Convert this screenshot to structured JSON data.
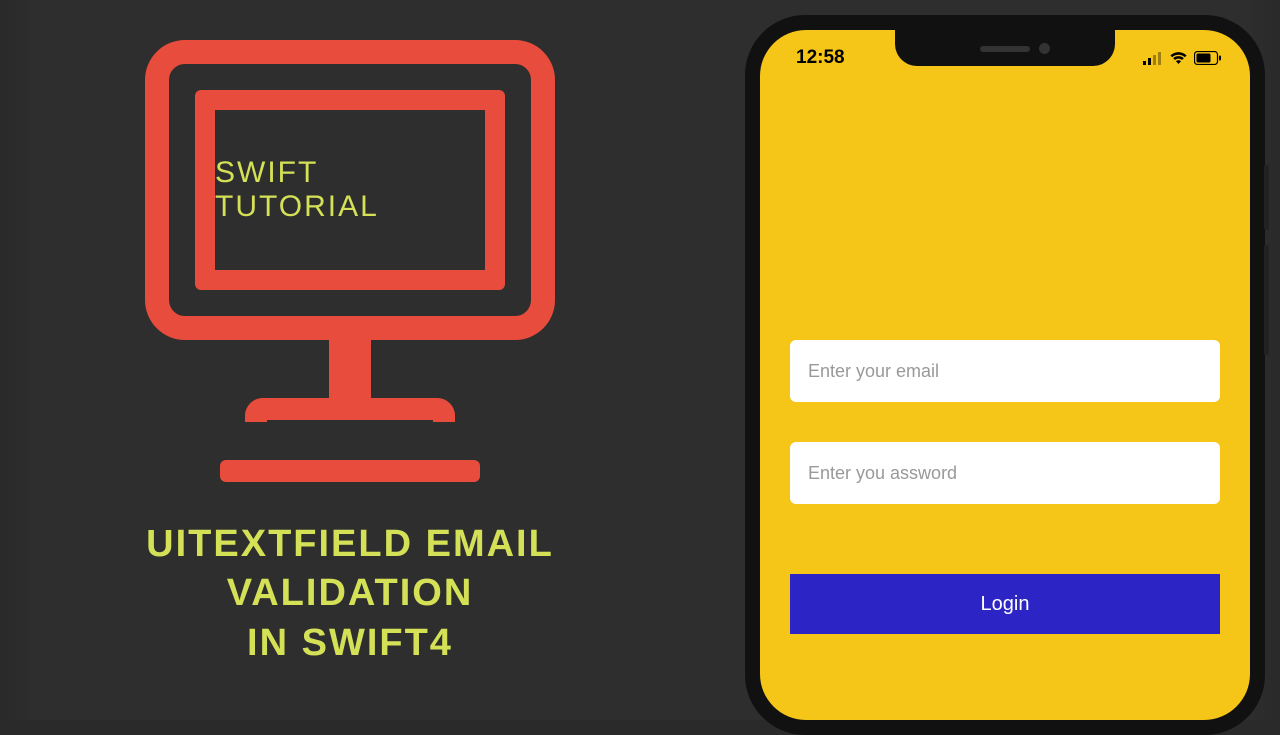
{
  "left": {
    "monitor_text": "SWIFT TUTORIAL",
    "title_line1": "UITEXTFIELD EMAIL",
    "title_line2": "VALIDATION",
    "title_line3": "IN SWIFT4"
  },
  "phone": {
    "status_bar": {
      "time": "12:58"
    },
    "form": {
      "email_placeholder": "Enter your email",
      "password_placeholder": "Enter you assword",
      "login_label": "Login"
    }
  },
  "colors": {
    "accent_red": "#e74c3c",
    "accent_yellow": "#d4e157",
    "phone_bg": "#f5c518",
    "button_blue": "#2c24c4"
  }
}
